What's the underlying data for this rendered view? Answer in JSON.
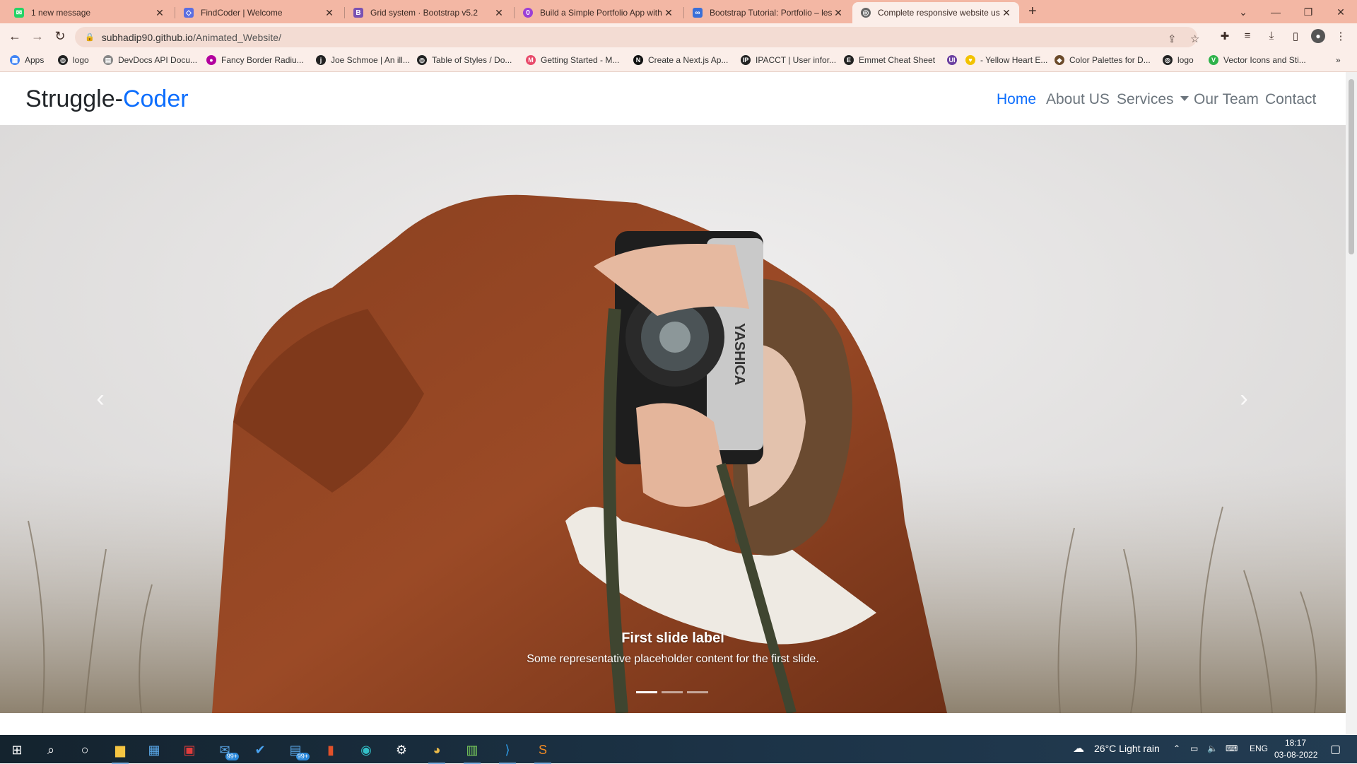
{
  "browser": {
    "tabs": [
      {
        "title": "1 new message",
        "icon": "whatsapp-icon",
        "color": "#25d366"
      },
      {
        "title": "FindCoder | Welcome",
        "icon": "findcoder-icon",
        "color": "#5b6ee1"
      },
      {
        "title": "Grid system · Bootstrap v5.2",
        "icon": "bootstrap-icon",
        "color": "#7952b3"
      },
      {
        "title": "Build a Simple Portfolio App with",
        "icon": "blog-icon",
        "color": "#9b3fd6"
      },
      {
        "title": "Bootstrap Tutorial: Portfolio – les",
        "icon": "tutorial-icon",
        "color": "#3a6fd8"
      },
      {
        "title": "Complete responsive website us",
        "icon": "globe-icon",
        "color": "#555555"
      }
    ],
    "active_tab": 5,
    "url_host": "subhadip90.github.io",
    "url_path": "/Animated_Website/",
    "bookmarks": [
      {
        "label": "Apps",
        "icon": "apps-grid-icon",
        "color": "#4285f4"
      },
      {
        "label": "logo",
        "icon": "globe-icon",
        "color": "#222222"
      },
      {
        "label": "DevDocs API Docu...",
        "icon": "devdocs-icon",
        "color": "#888888"
      },
      {
        "label": "Fancy Border Radiu...",
        "icon": "blob-icon",
        "color": "#b3009e"
      },
      {
        "label": "Joe Schmoe | An ill...",
        "icon": "j-icon",
        "color": "#222222"
      },
      {
        "label": "Table of Styles / Do...",
        "icon": "globe-icon",
        "color": "#222222"
      },
      {
        "label": "Getting Started - M...",
        "icon": "mui-icon",
        "color": "#e84a6a"
      },
      {
        "label": "Create a Next.js Ap...",
        "icon": "nextjs-icon",
        "color": "#111111"
      },
      {
        "label": "IPACCT | User infor...",
        "icon": "ip-icon",
        "color": "#222222"
      },
      {
        "label": "Emmet Cheat Sheet",
        "icon": "emmet-icon",
        "color": "#222222"
      },
      {
        "label": "",
        "icon": "ui-icon",
        "color": "#6b3fa0"
      },
      {
        "label": "- Yellow Heart E...",
        "icon": "heart-icon",
        "color": "#f2c200"
      },
      {
        "label": "Color Palettes for D...",
        "icon": "palette-icon",
        "color": "#6b4a2a"
      },
      {
        "label": "logo",
        "icon": "globe-icon",
        "color": "#222222"
      },
      {
        "label": "Vector Icons and Sti...",
        "icon": "vector-icon",
        "color": "#2db24a"
      }
    ]
  },
  "site": {
    "brand_main": "Struggle-",
    "brand_accent": "Coder",
    "nav": [
      "Home",
      "About US",
      "Services",
      "Our Team",
      "Contact"
    ],
    "active_nav": "Home",
    "accent_color": "#0d6efd",
    "carousel": {
      "caption_title": "First slide label",
      "caption_text": "Some representative placeholder content for the first slide.",
      "indicator_count": 3,
      "active_index": 0,
      "camera_brand": "YASHICA"
    }
  },
  "taskbar": {
    "weather": "26°C  Light rain",
    "language": "ENG",
    "time": "18:17",
    "date": "03-08-2022",
    "badge_99": "99+"
  }
}
